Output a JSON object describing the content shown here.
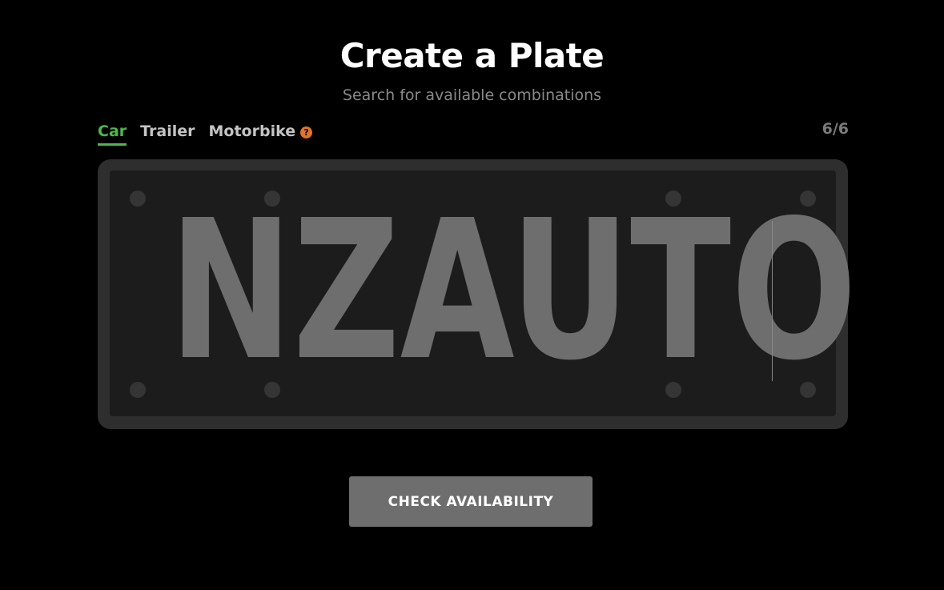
{
  "header": {
    "title": "Create a Plate",
    "subtitle": "Search for available combinations"
  },
  "tabs": [
    {
      "label": "Car",
      "active": true
    },
    {
      "label": "Trailer",
      "active": false
    },
    {
      "label": "Motorbike",
      "active": false,
      "help_icon": "question-circle-icon"
    }
  ],
  "help_icon_glyph": "?",
  "counter": "6/6",
  "plate": {
    "text": "NZAUTO"
  },
  "actions": {
    "check_label": "CHECK AVAILABILITY"
  },
  "colors": {
    "background": "#000000",
    "accent": "#4db848",
    "help_icon": "#e2742d",
    "plate_text": "#6e6e6e",
    "button": "#6e6e6e"
  }
}
